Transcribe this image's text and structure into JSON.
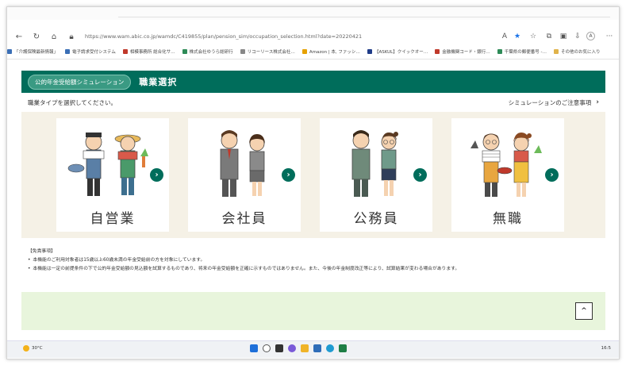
{
  "browser": {
    "url": "https://www.wam.abic.co.jp/wamdc/C419855/plan/pension_sim/occupation_selection.html?date=20220421",
    "reader_icon": "A",
    "profile_letter": "A",
    "more": "···"
  },
  "bookmarks": [
    {
      "label": "「介護保険最新情報」",
      "color": "#3b6fb6"
    },
    {
      "label": "電子請求受付システム",
      "color": "#3b6fb6"
    },
    {
      "label": "相模事務所 総合化サ…",
      "color": "#c0392b"
    },
    {
      "label": "株式会社ゆうら総研行",
      "color": "#2e8b57"
    },
    {
      "label": "リコーリース株式会社…",
      "color": "#888888"
    },
    {
      "label": "Amazon | 本, ファッシ…",
      "color": "#e6a100"
    },
    {
      "label": "【ASKUL】クイックオー…",
      "color": "#1f3c88"
    },
    {
      "label": "金融機関コード・銀行…",
      "color": "#c0392b"
    },
    {
      "label": "千葉県の郵便番号 -…",
      "color": "#2e8b57"
    },
    {
      "label": "その他のお気に入り",
      "color": "#e0b34a"
    }
  ],
  "page": {
    "badge": "公的年金受給額シミュレーション",
    "title": "職業選択",
    "instruction": "職業タイプを選択してください。",
    "notice_link": "シミュレーションのご注意事項",
    "chevron": "›"
  },
  "cards": [
    {
      "label": "自営業"
    },
    {
      "label": "会社員"
    },
    {
      "label": "公務員"
    },
    {
      "label": "無職"
    }
  ],
  "disclaimer": {
    "heading": "【免責事項】",
    "items": [
      "本機能のご利用対象者は15歳以上60歳未満の年金受給前の方を対象にしています。",
      "本機能は一定の前提条件の下で公的年金受給額の見込額を試算するものであり、将来の年金受給額を正確に示すものではありません。また、今後の年金制度改正等により、試算結果が変わる場合があります。"
    ]
  },
  "back_to_top": "^",
  "taskbar": {
    "weather": "30°C",
    "time": "16:5"
  },
  "colors": {
    "header": "#006d5b",
    "cards_bg": "#f5f1e6",
    "footer_band": "#e8f5dc"
  }
}
